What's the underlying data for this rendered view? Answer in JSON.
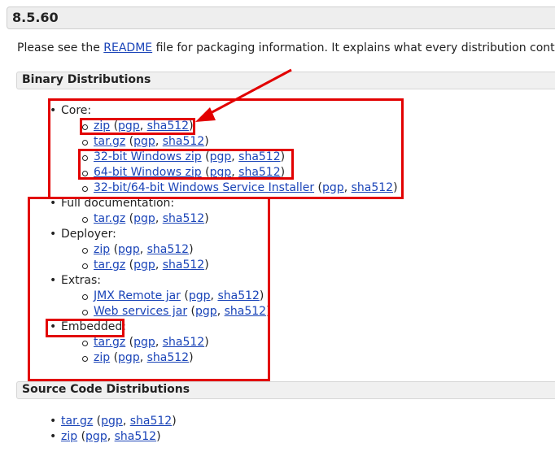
{
  "version": "8.5.60",
  "intro": {
    "before": "Please see the ",
    "link": "README",
    "after": " file for packaging information. It explains what every distribution contains."
  },
  "sections": {
    "binary": "Binary Distributions",
    "source": "Source Code Distributions"
  },
  "binary_groups": [
    {
      "label": "Core:",
      "items": [
        {
          "name": "zip",
          "sig": "pgp",
          "hash": "sha512"
        },
        {
          "name": "tar.gz",
          "sig": "pgp",
          "hash": "sha512"
        },
        {
          "name": "32-bit Windows zip",
          "sig": "pgp",
          "hash": "sha512"
        },
        {
          "name": "64-bit Windows zip",
          "sig": "pgp",
          "hash": "sha512"
        },
        {
          "name": "32-bit/64-bit Windows Service Installer",
          "sig": "pgp",
          "hash": "sha512"
        }
      ]
    },
    {
      "label": "Full documentation:",
      "items": [
        {
          "name": "tar.gz",
          "sig": "pgp",
          "hash": "sha512"
        }
      ]
    },
    {
      "label": "Deployer:",
      "items": [
        {
          "name": "zip",
          "sig": "pgp",
          "hash": "sha512"
        },
        {
          "name": "tar.gz",
          "sig": "pgp",
          "hash": "sha512"
        }
      ]
    },
    {
      "label": "Extras:",
      "items": [
        {
          "name": "JMX Remote jar",
          "sig": "pgp",
          "hash": "sha512"
        },
        {
          "name": "Web services jar",
          "sig": "pgp",
          "hash": "sha512"
        }
      ]
    },
    {
      "label": "Embedded:",
      "items": [
        {
          "name": "tar.gz",
          "sig": "pgp",
          "hash": "sha512"
        },
        {
          "name": "zip",
          "sig": "pgp",
          "hash": "sha512"
        }
      ]
    }
  ],
  "source_items": [
    {
      "name": "tar.gz",
      "sig": "pgp",
      "hash": "sha512"
    },
    {
      "name": "zip",
      "sig": "pgp",
      "hash": "sha512"
    }
  ],
  "colors": {
    "link": "#1a44b8",
    "annotation": "#e20000",
    "section_bg": "#f0f0f0"
  }
}
